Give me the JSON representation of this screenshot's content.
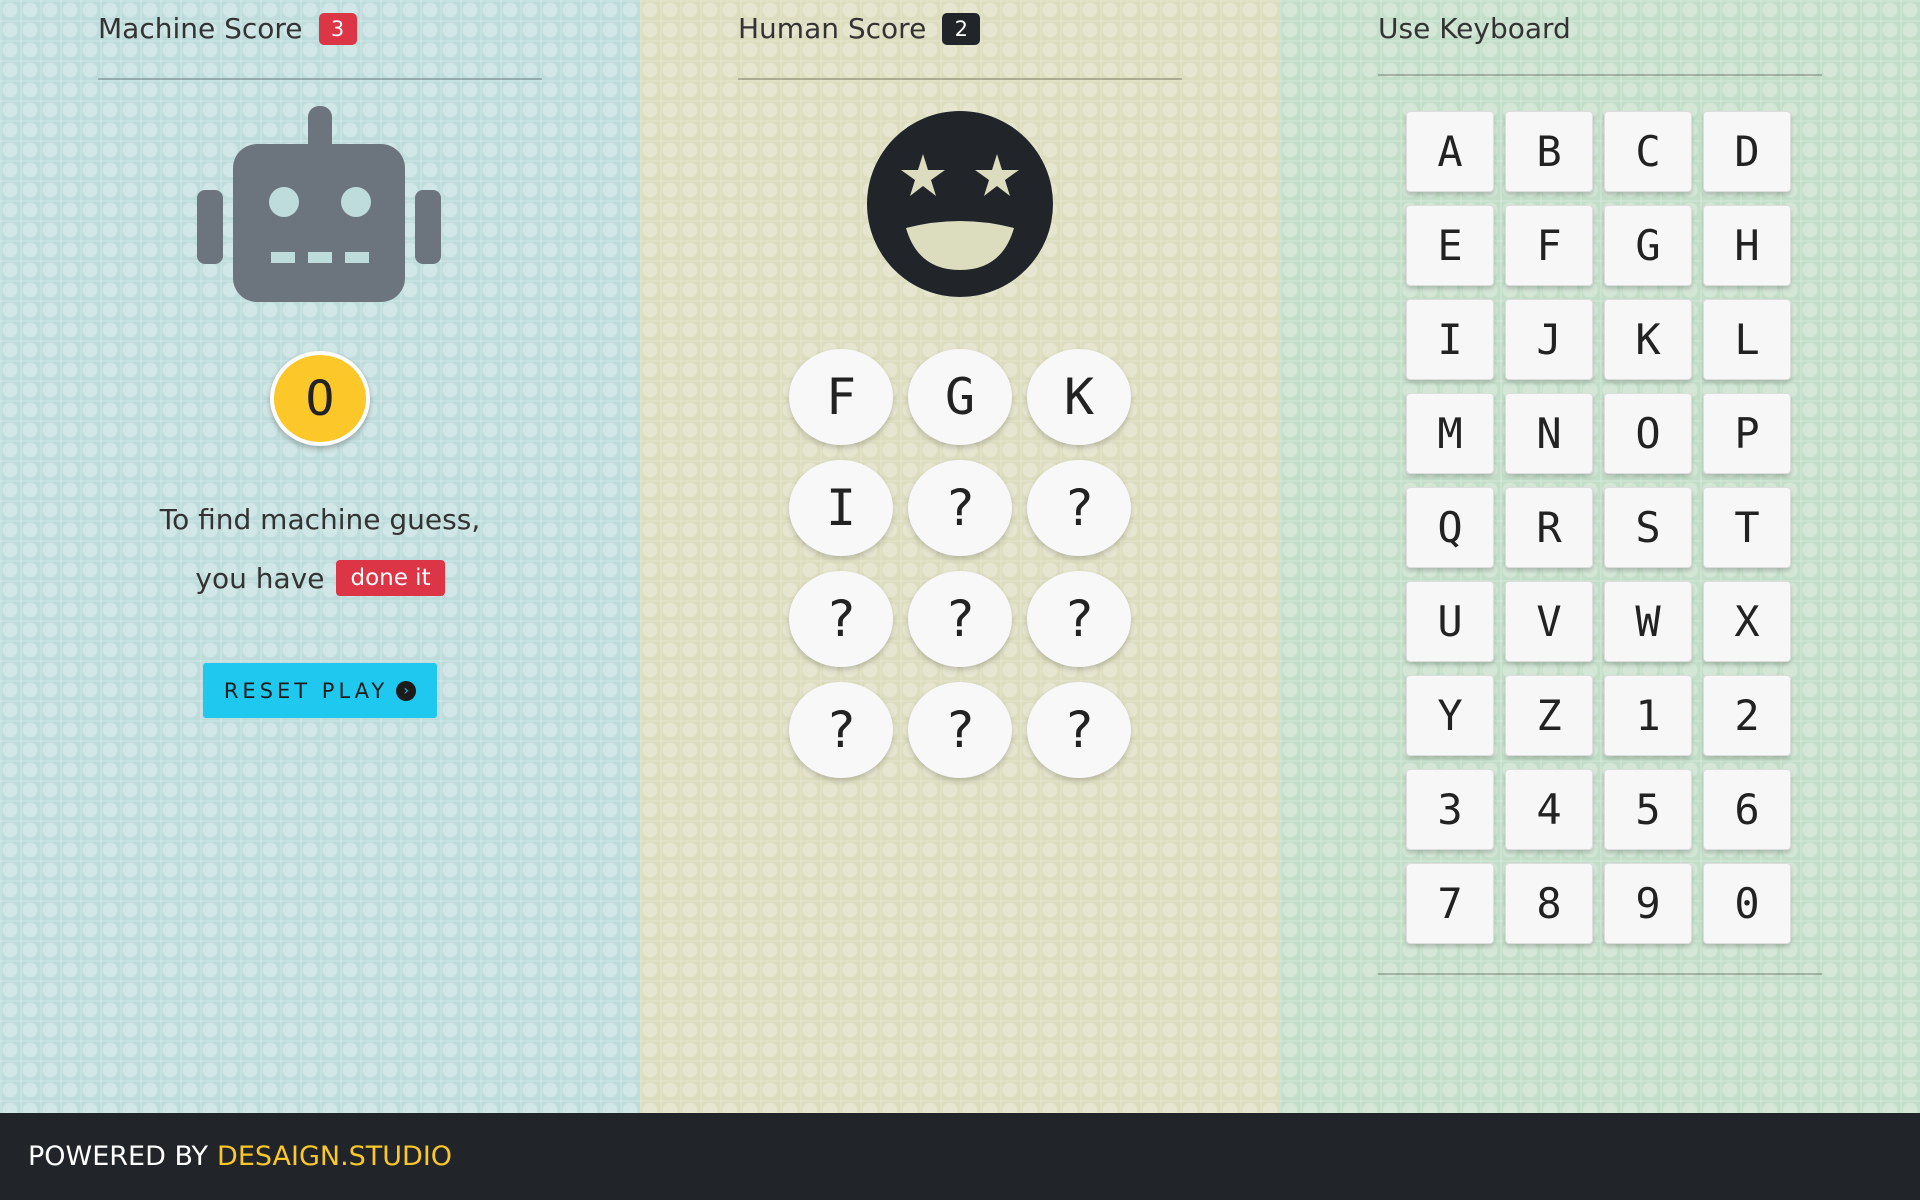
{
  "machine": {
    "score_label": "Machine Score",
    "score": "3",
    "guess": "O",
    "message_line1": "To find machine guess,",
    "message_line2": "you have",
    "status_badge": "done it",
    "reset_button": "RESET PLAY",
    "icon": "robot-icon"
  },
  "human": {
    "score_label": "Human Score",
    "score": "2",
    "icon": "grin-stars-icon",
    "guesses": [
      "F",
      "G",
      "K",
      "I",
      "?",
      "?",
      "?",
      "?",
      "?",
      "?",
      "?",
      "?"
    ]
  },
  "keyboard": {
    "title": "Use Keyboard",
    "keys": [
      "A",
      "B",
      "C",
      "D",
      "E",
      "F",
      "G",
      "H",
      "I",
      "J",
      "K",
      "L",
      "M",
      "N",
      "O",
      "P",
      "Q",
      "R",
      "S",
      "T",
      "U",
      "V",
      "W",
      "X",
      "Y",
      "Z",
      "1",
      "2",
      "3",
      "4",
      "5",
      "6",
      "7",
      "8",
      "9",
      "0"
    ]
  },
  "footer": {
    "powered_by": "POWERED BY",
    "brand": "DESAIGN.STUDIO"
  },
  "colors": {
    "accent_yellow": "#fcc729",
    "danger_red": "#dc3545",
    "button_cyan": "#1fc8ee",
    "dark": "#212529"
  }
}
